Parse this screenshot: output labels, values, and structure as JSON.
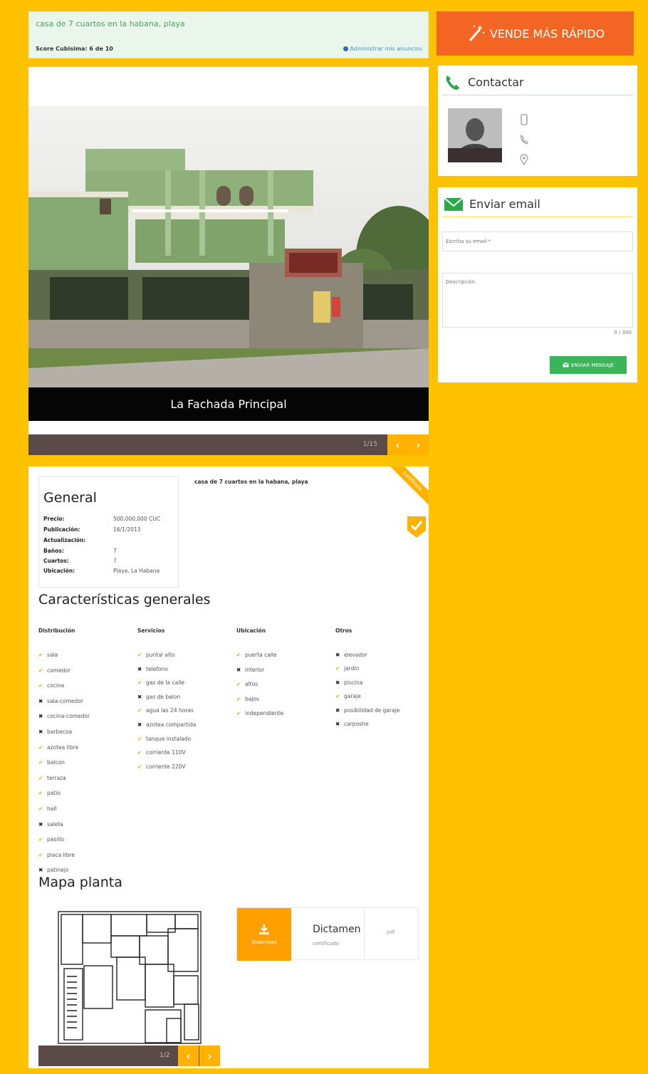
{
  "banner": {
    "title": "casa de 7 cuartos en la habana, playa",
    "score": "Score Cubisima: 6 de 10",
    "admin_link": "Administrar mis anuncios"
  },
  "sell_button": {
    "label": "VENDE MÁS RÁPIDO",
    "icon": "magic-wand-icon"
  },
  "gallery": {
    "caption": "La Fachada Principal",
    "counter": "1/15",
    "prev_label": "‹",
    "next_label": "›"
  },
  "contact": {
    "title": "Contactar",
    "icons": [
      "phone-icon",
      "mobile-icon",
      "phone-handset-icon",
      "location-pin-icon"
    ]
  },
  "email_form": {
    "title": "Enviar email",
    "email_placeholder": "Escriba su email *",
    "description_placeholder": "Descripción",
    "char_count": "0 / 300",
    "send_label": "ENVIAR MENSAJE"
  },
  "details": {
    "listing_title": "casa de 7 cuartos en la habana, playa",
    "ribbon": "Certificada",
    "general": {
      "heading": "General",
      "rows": [
        {
          "key": "Precio:",
          "value": "500.000,000 CUC"
        },
        {
          "key": "Publicación:",
          "value": "16/1/2013"
        },
        {
          "key": "Actualización:",
          "value": ""
        },
        {
          "key": "Baños:",
          "value": "7"
        },
        {
          "key": "Cuartos:",
          "value": "7"
        },
        {
          "key": "Ubicación:",
          "value": "Playa, La Habana"
        }
      ]
    },
    "features_heading": "Características generales",
    "columns": [
      {
        "heading": "Distribución",
        "items": [
          {
            "label": "sala",
            "has": true
          },
          {
            "label": "comedor",
            "has": true
          },
          {
            "label": "cocina",
            "has": true
          },
          {
            "label": "sala-comedor",
            "has": false
          },
          {
            "label": "cocina-comedor",
            "has": false
          },
          {
            "label": "barbecoa",
            "has": false
          },
          {
            "label": "azotea libre",
            "has": true
          },
          {
            "label": "balcon",
            "has": true
          },
          {
            "label": "terraza",
            "has": true
          },
          {
            "label": "patio",
            "has": true
          },
          {
            "label": "hall",
            "has": true
          },
          {
            "label": "saleta",
            "has": false
          },
          {
            "label": "pasillo",
            "has": true
          },
          {
            "label": "placa libre",
            "has": true
          },
          {
            "label": "patinejo",
            "has": false
          }
        ]
      },
      {
        "heading": "Servicios",
        "items": [
          {
            "label": "puntal alto",
            "has": true
          },
          {
            "label": "telefono",
            "has": false
          },
          {
            "label": "gas de la calle",
            "has": true
          },
          {
            "label": "gas de balon",
            "has": false
          },
          {
            "label": "agua las 24 horas",
            "has": true
          },
          {
            "label": "azotea compartida",
            "has": false
          },
          {
            "label": "tanque instalado",
            "has": true
          },
          {
            "label": "corriente 110V",
            "has": true
          },
          {
            "label": "corriente 220V",
            "has": true
          }
        ]
      },
      {
        "heading": "Ubicación",
        "items": [
          {
            "label": "puerta calle",
            "has": true
          },
          {
            "label": "interior",
            "has": false
          },
          {
            "label": "altos",
            "has": true
          },
          {
            "label": "bajos",
            "has": true
          },
          {
            "label": "independiente",
            "has": true
          }
        ]
      },
      {
        "heading": "Otros",
        "items": [
          {
            "label": "elevador",
            "has": false
          },
          {
            "label": "jardin",
            "has": true
          },
          {
            "label": "piscina",
            "has": false
          },
          {
            "label": "garaje",
            "has": true
          },
          {
            "label": "posibilidad de garaje",
            "has": false
          },
          {
            "label": "carposhe",
            "has": false
          }
        ]
      }
    ],
    "plan_heading": "Mapa planta",
    "plan_counter": "1/2",
    "document": {
      "download_label": "Download",
      "name": "Dictamen",
      "subtitle": "certificado",
      "extension": "pdf"
    }
  },
  "colors": {
    "background": "#FFC200",
    "accent_orange": "#F26522",
    "check_orange": "#F5A200",
    "send_green": "#3CB55A",
    "nav_yellow": "#FFB300"
  }
}
